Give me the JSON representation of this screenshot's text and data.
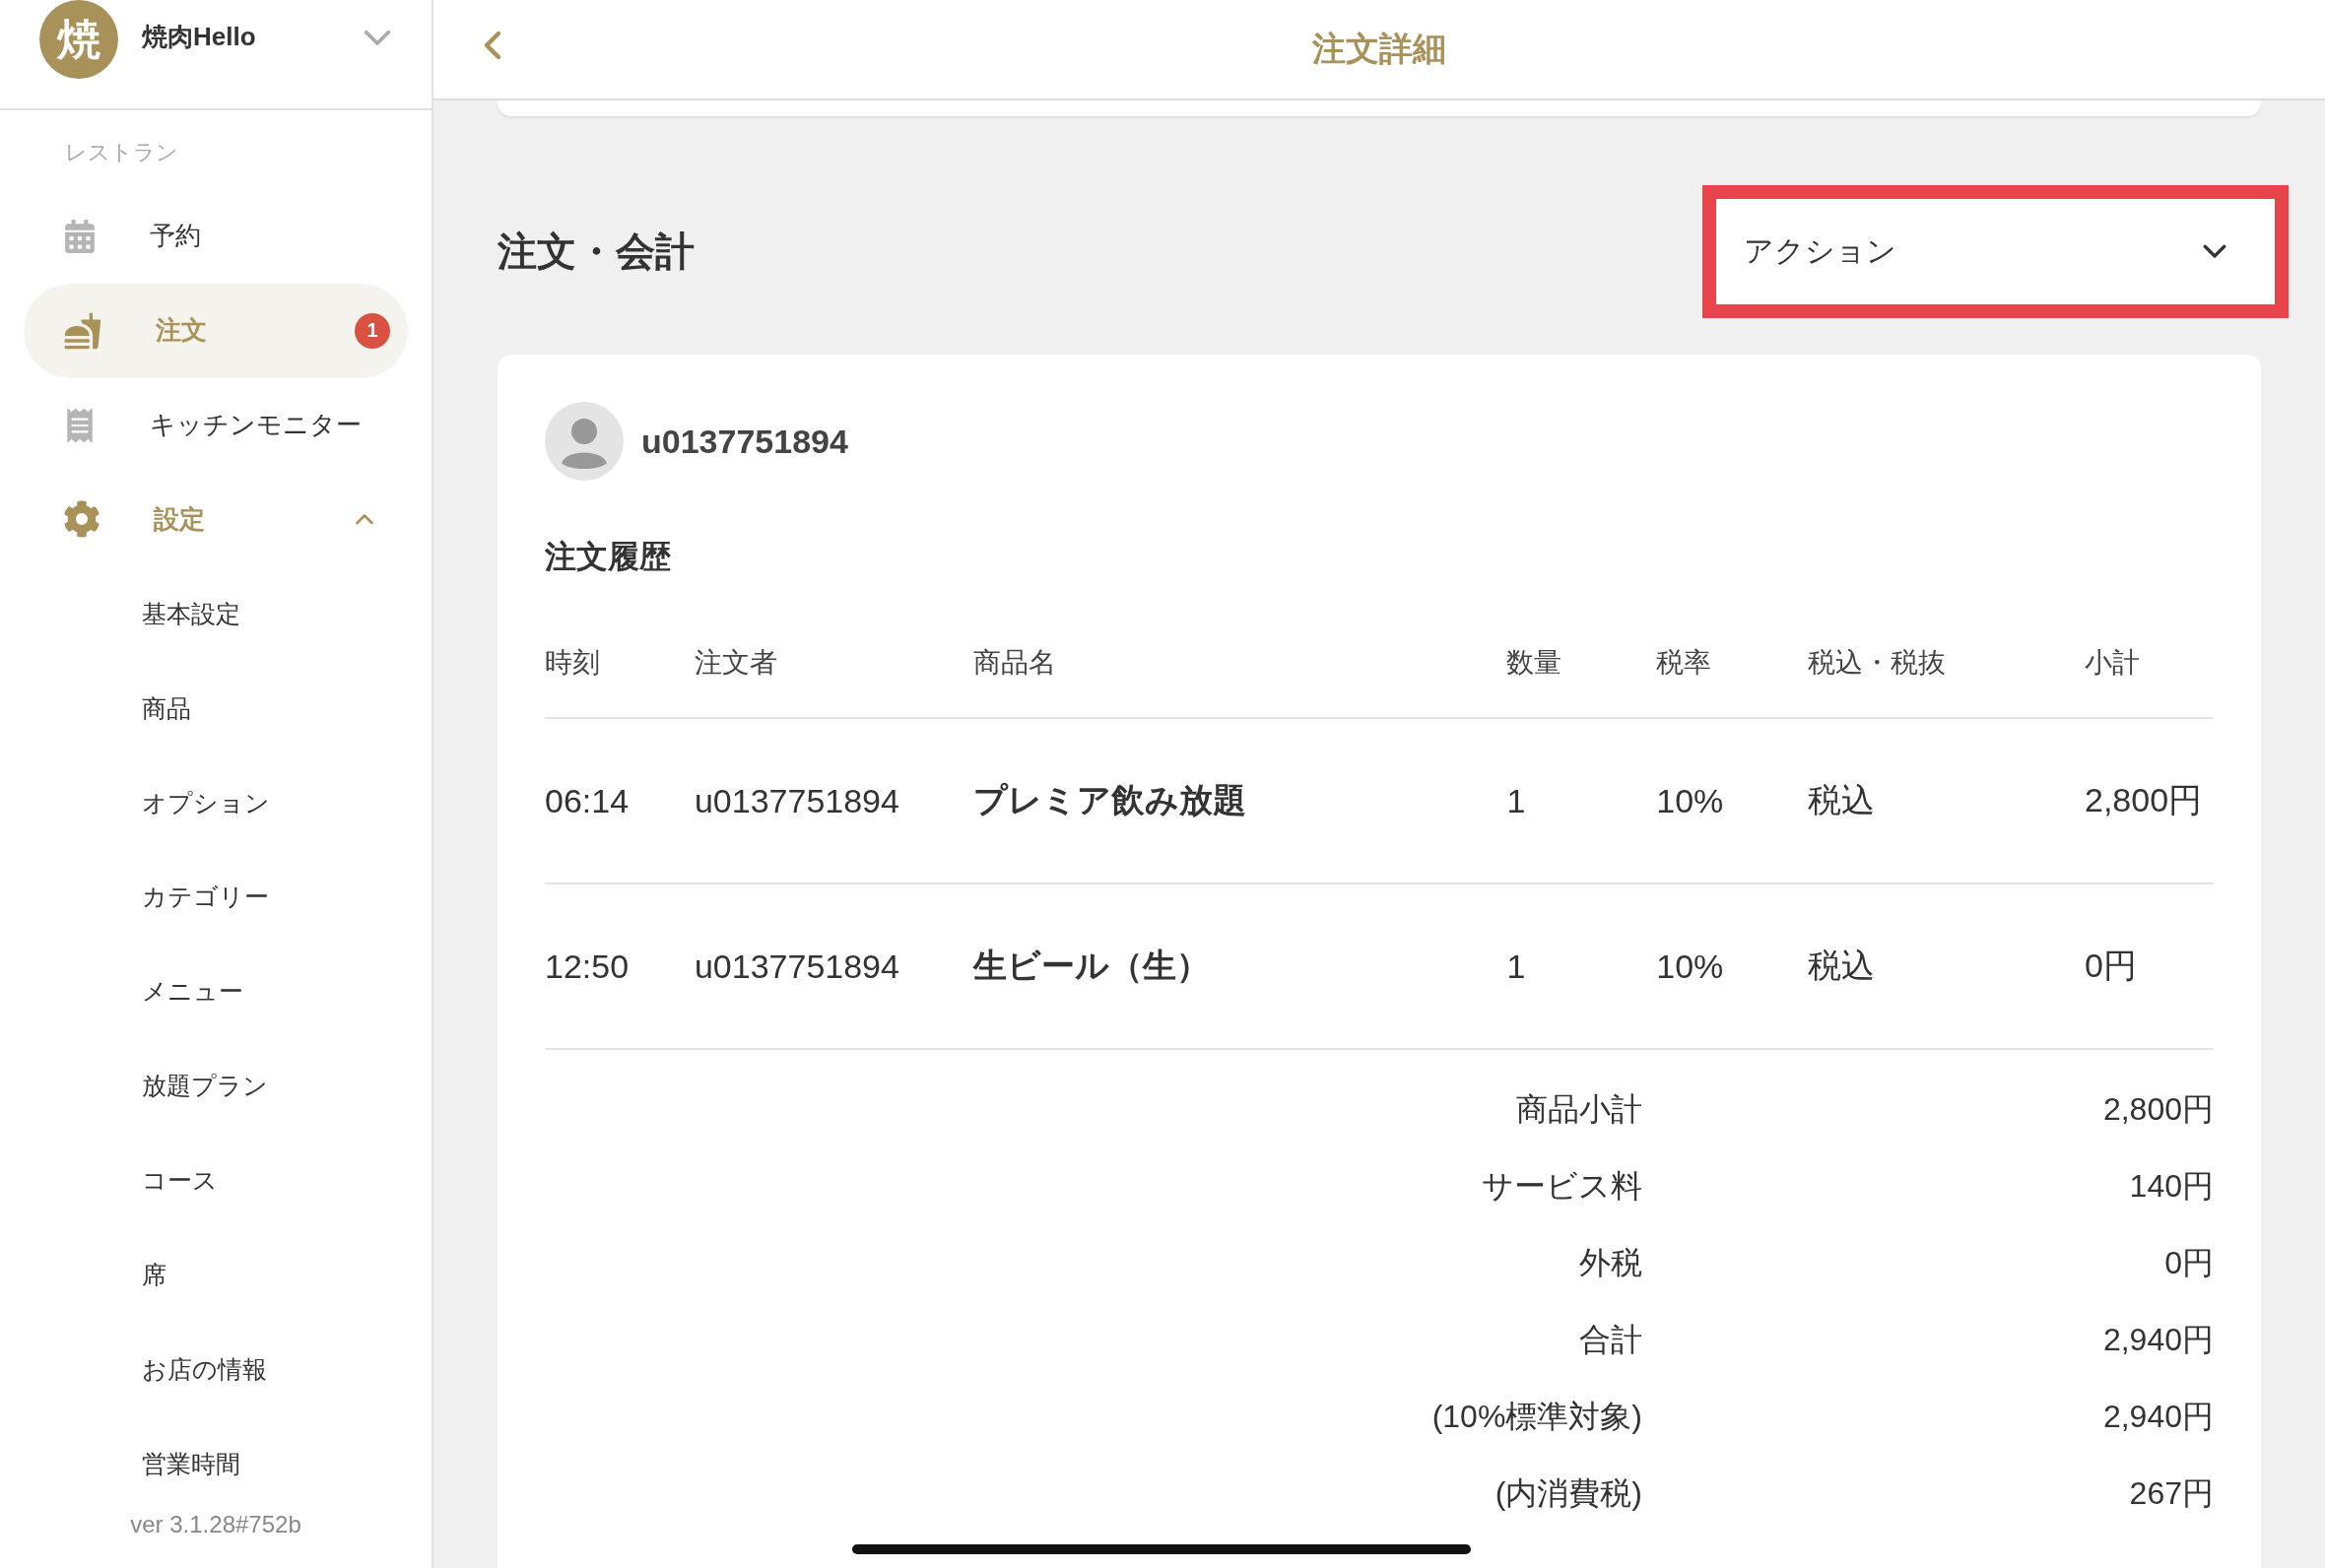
{
  "sidebar": {
    "brand": {
      "avatar_text": "焼",
      "name": "焼肉Hello"
    },
    "section_label": "レストラン",
    "items": [
      {
        "kind": "calendar",
        "label": "予約",
        "selected": false
      },
      {
        "kind": "order",
        "label": "注文",
        "selected": true,
        "badge": "1"
      },
      {
        "kind": "receipt",
        "label": "キッチンモニター",
        "selected": false
      },
      {
        "kind": "gear",
        "label": "設定",
        "selected": false,
        "expanded": true,
        "children": [
          {
            "label": "基本設定"
          },
          {
            "label": "商品"
          },
          {
            "label": "オプション"
          },
          {
            "label": "カテゴリー"
          },
          {
            "label": "メニュー"
          },
          {
            "label": "放題プラン"
          },
          {
            "label": "コース"
          },
          {
            "label": "席"
          },
          {
            "label": "お店の情報"
          },
          {
            "label": "営業時間"
          }
        ]
      }
    ],
    "version": "ver 3.1.28#752b"
  },
  "header": {
    "title": "注文詳細"
  },
  "section": {
    "title": "注文・会計",
    "action_select": {
      "value": "アクション",
      "highlighted": true
    }
  },
  "customer": {
    "name": "u0137751894"
  },
  "history": {
    "title": "注文履歴",
    "columns": [
      "時刻",
      "注文者",
      "商品名",
      "数量",
      "税率",
      "税込・税抜",
      "小計"
    ],
    "rows": [
      {
        "time": "06:14",
        "orderer": "u0137751894",
        "product": "プレミア飲み放題",
        "quantity": "1",
        "tax_rate": "10%",
        "tax_type": "税込",
        "subtotal": "2,800円"
      },
      {
        "time": "12:50",
        "orderer": "u0137751894",
        "product": "生ビール（生）",
        "quantity": "1",
        "tax_rate": "10%",
        "tax_type": "税込",
        "subtotal": "0円"
      }
    ]
  },
  "totals": [
    {
      "label": "商品小計",
      "value": "2,800円"
    },
    {
      "label": "サービス料",
      "value": "140円"
    },
    {
      "label": "外税",
      "value": "0円"
    },
    {
      "label": "合計",
      "value": "2,940円"
    },
    {
      "label": "(10%標準対象)",
      "value": "2,940円"
    },
    {
      "label": "(内消費税)",
      "value": "267円"
    }
  ]
}
